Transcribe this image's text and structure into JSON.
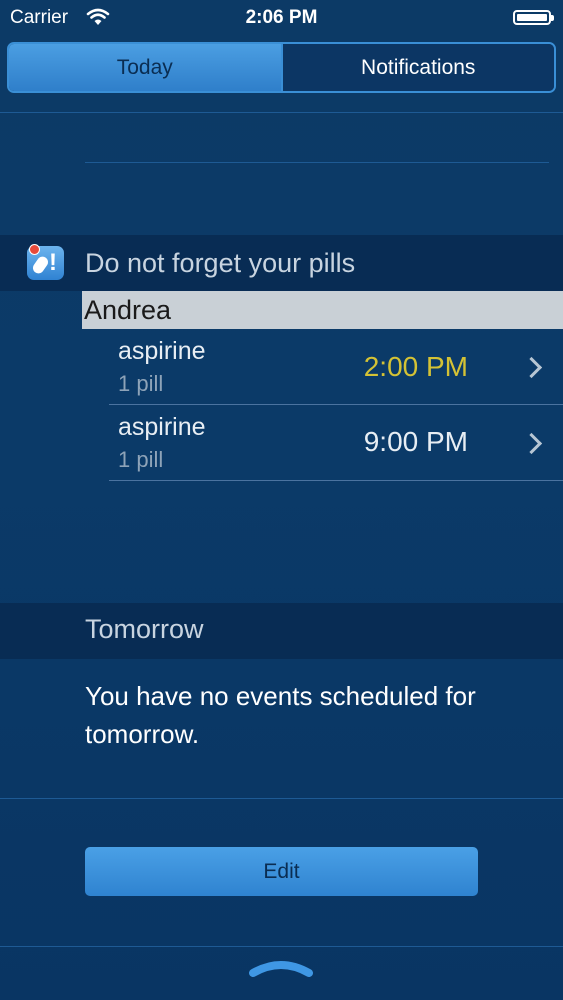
{
  "status_bar": {
    "carrier": "Carrier",
    "time": "2:06 PM"
  },
  "tabs": [
    {
      "label": "Today",
      "active": true
    },
    {
      "label": "Notifications",
      "active": false
    }
  ],
  "pills_section": {
    "title": "Do not forget your pills",
    "icon": "pill-app-icon",
    "person": "Andrea",
    "items": [
      {
        "name": "aspirine",
        "qty": "1 pill",
        "time": "2:00 PM",
        "time_color": "#d4c235"
      },
      {
        "name": "aspirine",
        "qty": "1 pill",
        "time": "9:00 PM",
        "time_color": "#e8eef4"
      }
    ]
  },
  "tomorrow": {
    "title": "Tomorrow",
    "message": "You have no events scheduled for tomorrow."
  },
  "edit_button": "Edit",
  "colors": {
    "background": "#0b3a68",
    "accent": "#3a8fd6",
    "highlight_time": "#d4c235"
  }
}
